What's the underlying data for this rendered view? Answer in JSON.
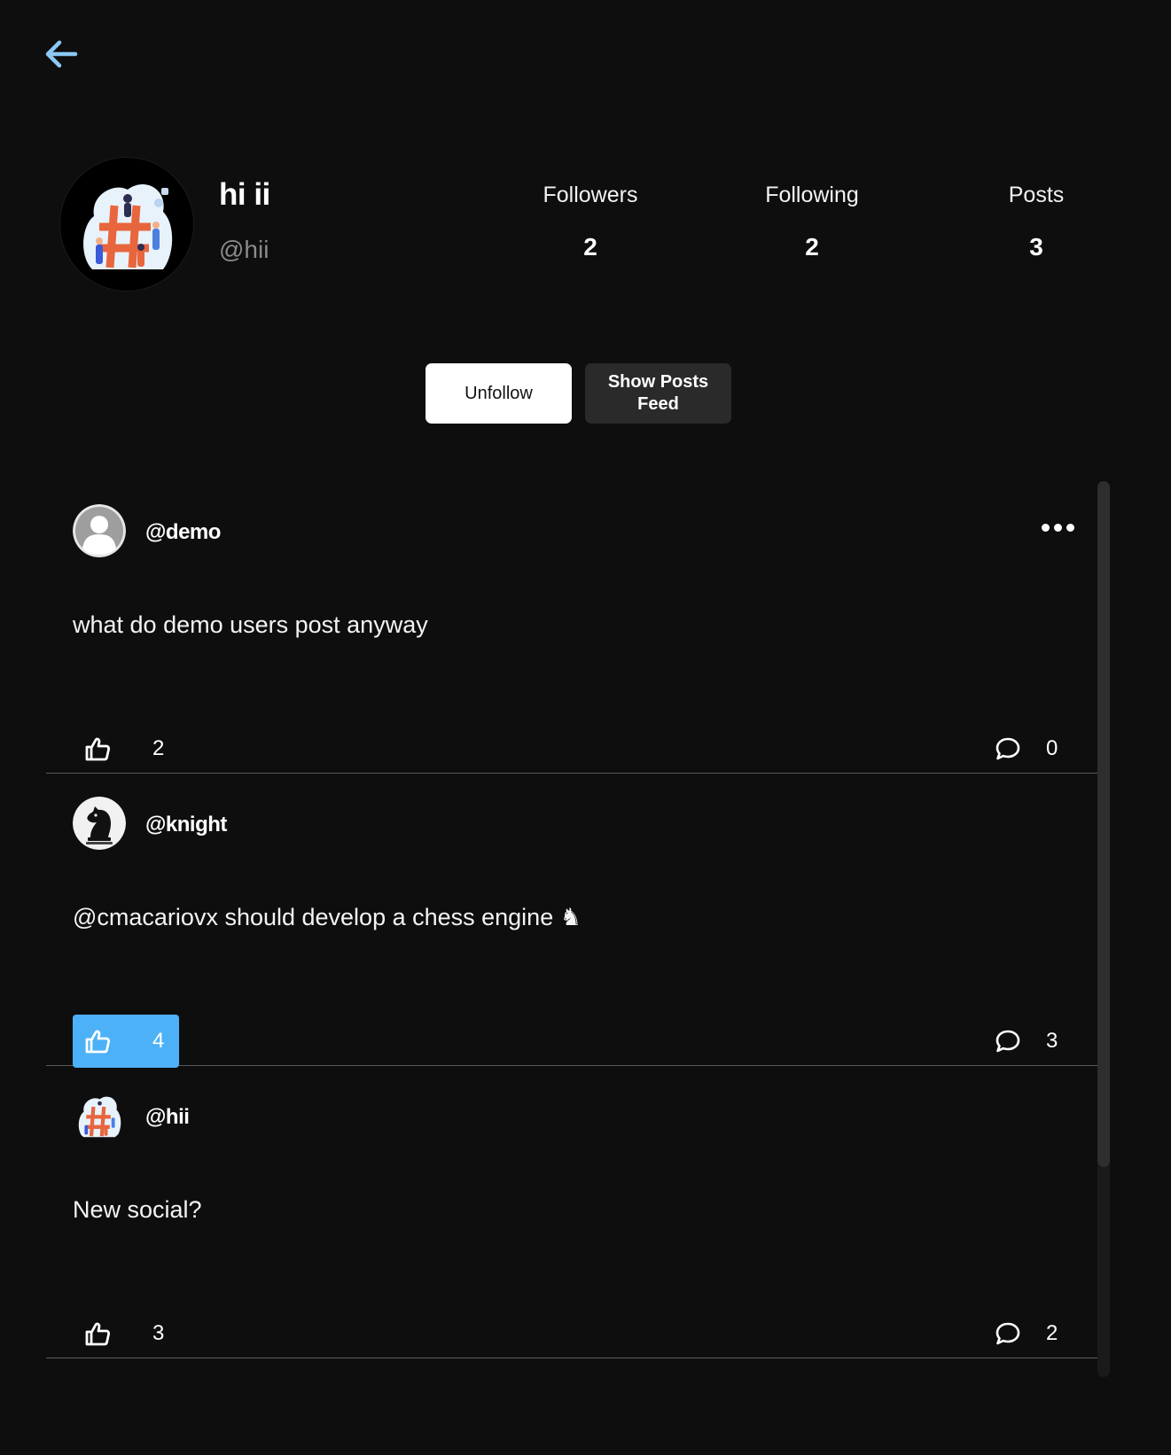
{
  "profile": {
    "display_name": "hi ii",
    "handle": "@hii",
    "stats": [
      {
        "label": "Followers",
        "value": "2"
      },
      {
        "label": "Following",
        "value": "2"
      },
      {
        "label": "Posts",
        "value": "3"
      }
    ]
  },
  "actions": {
    "unfollow_label": "Unfollow",
    "feed_label": "Show Posts Feed"
  },
  "posts": [
    {
      "user": "@demo",
      "text": "what do demo users post anyway",
      "likes": "2",
      "comments": "0",
      "liked": false
    },
    {
      "user": "@knight",
      "text": "@cmacariovx should develop a chess engine ♞",
      "likes": "4",
      "comments": "3",
      "liked": true
    },
    {
      "user": "@hii",
      "text": "New social?",
      "likes": "3",
      "comments": "2",
      "liked": false
    }
  ],
  "colors": {
    "background": "#0e0e0f",
    "accent": "#4db1f7",
    "back_arrow": "#8cc8f4"
  }
}
